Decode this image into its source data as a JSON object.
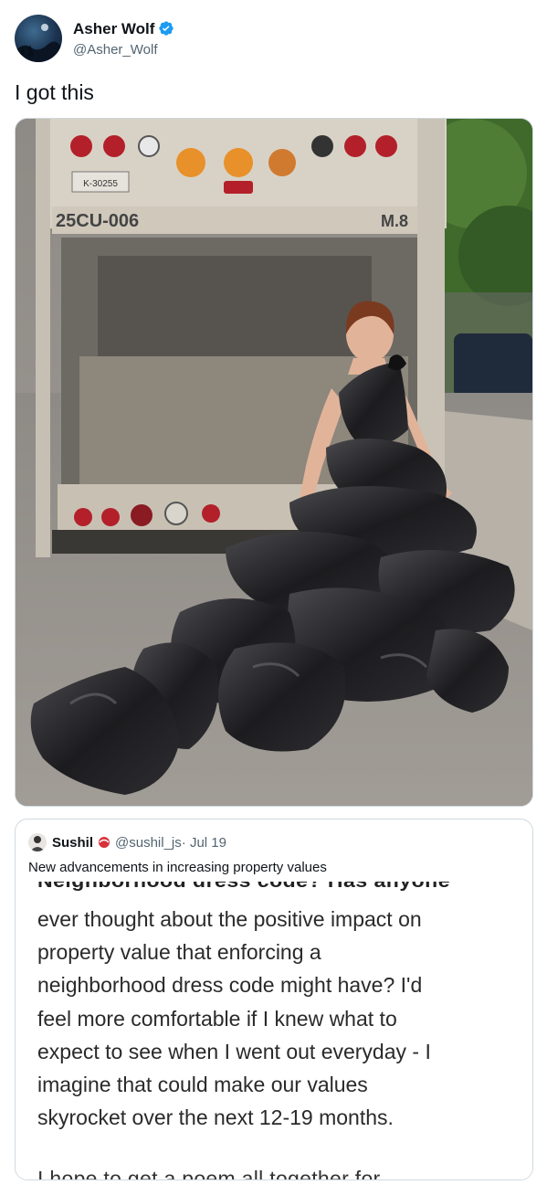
{
  "tweet": {
    "author_name": "Asher Wolf",
    "author_handle": "@Asher_Wolf",
    "text": "I got this",
    "image_alt_icon": "photo-garbage-truck-trash-bag-dress"
  },
  "quoted_tweet": {
    "author_name": "Sushil",
    "author_handle": "@sushil_js",
    "date": "· Jul 19",
    "text": "New advancements in increasing property values",
    "image": {
      "cut_top_line": "Neighborhood dress code? Has anyone",
      "lines": [
        "ever thought about the positive impact on",
        "property value that enforcing a",
        "neighborhood dress code might have? I'd",
        "feel more comfortable if I knew what to",
        "expect to see when I went out everyday - I",
        "imagine that could make our values",
        "skyrocket over the next 12-19 months."
      ],
      "cut_bottom_line": "I hope to get a poem all together for"
    }
  },
  "photo_text": {
    "truck_number": "25CU-006",
    "truck_code": "M.8",
    "plate": "K-30255"
  },
  "colors": {
    "verified": "#1d9bf0",
    "border": "#cfd9de",
    "secondary_text": "#536471"
  }
}
